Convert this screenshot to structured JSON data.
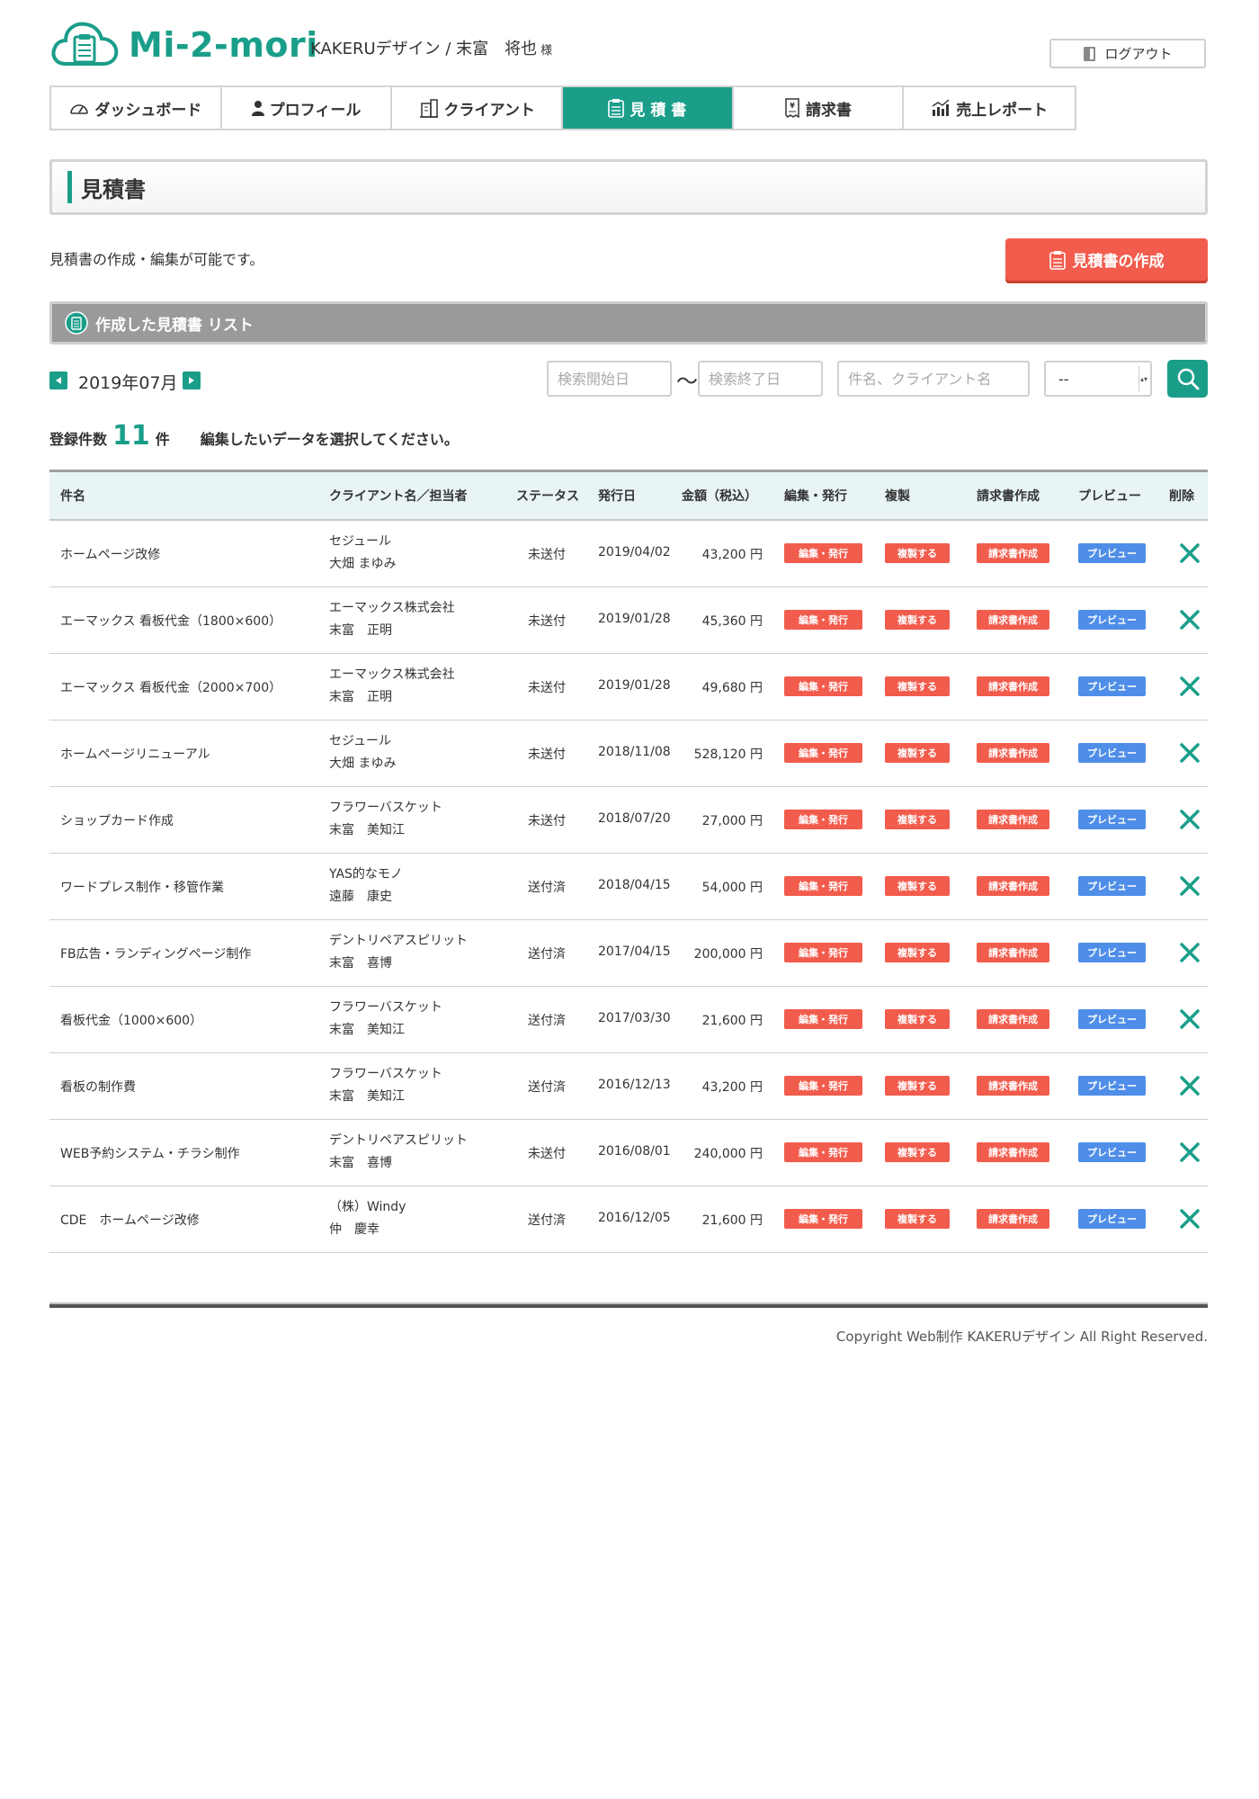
{
  "header": {
    "logo_text": "Mi-2-mori",
    "user_name": "KAKERUデザイン / 末富　将也",
    "user_suffix": "様",
    "logout_label": "ログアウト"
  },
  "nav": {
    "items": [
      {
        "label": "ダッシュボード"
      },
      {
        "label": "プロフィール"
      },
      {
        "label": "クライアント"
      },
      {
        "label": "見 積 書"
      },
      {
        "label": "請求書"
      },
      {
        "label": "売上レポート"
      }
    ],
    "active": "見 積 書"
  },
  "page": {
    "title": "見積書",
    "description": "見積書の作成・編集が可能です。",
    "create_button": "見積書の作成",
    "list_title": "作成した見積書 リスト"
  },
  "filters": {
    "month": "2019年07月",
    "start_placeholder": "検索開始日",
    "tilde": "〜",
    "end_placeholder": "検索終了日",
    "keyword_placeholder": "件名、クライアント名",
    "status_select": "--"
  },
  "summary": {
    "label": "登録件数",
    "count": "11",
    "unit": "件",
    "message": "編集したいデータを選択してください。"
  },
  "table": {
    "headers": {
      "name": "件名",
      "client": "クライアント名／担当者",
      "status": "ステータス",
      "date": "発行日",
      "amount": "金額（税込）",
      "edit": "編集・発行",
      "copy": "複製",
      "invoice": "請求書作成",
      "preview": "プレビュー",
      "delete": "削除"
    },
    "buttons": {
      "edit": "編集・発行",
      "copy": "複製する",
      "invoice": "請求書作成",
      "preview": "プレビュー"
    },
    "rows": [
      {
        "name": "ホームページ改修",
        "client": "セジュール",
        "person": "大畑 まゆみ",
        "status": "未送付",
        "date": "2019/04/02",
        "amount": "43,200 円"
      },
      {
        "name": "エーマックス 看板代金（1800×600）",
        "client": "エーマックス株式会社",
        "person": "末富　正明",
        "status": "未送付",
        "date": "2019/01/28",
        "amount": "45,360 円"
      },
      {
        "name": "エーマックス 看板代金（2000×700）",
        "client": "エーマックス株式会社",
        "person": "末富　正明",
        "status": "未送付",
        "date": "2019/01/28",
        "amount": "49,680 円"
      },
      {
        "name": "ホームページリニューアル",
        "client": "セジュール",
        "person": "大畑 まゆみ",
        "status": "未送付",
        "date": "2018/11/08",
        "amount": "528,120 円"
      },
      {
        "name": "ショップカード作成",
        "client": "フラワーバスケット",
        "person": "末富　美知江",
        "status": "未送付",
        "date": "2018/07/20",
        "amount": "27,000 円"
      },
      {
        "name": "ワードプレス制作・移管作業",
        "client": "YAS的なモノ",
        "person": "遠藤　康史",
        "status": "送付済",
        "date": "2018/04/15",
        "amount": "54,000 円"
      },
      {
        "name": "FB広告・ランディングページ制作",
        "client": "デントリペアスピリット",
        "person": "末富　喜博",
        "status": "送付済",
        "date": "2017/04/15",
        "amount": "200,000 円"
      },
      {
        "name": "看板代金（1000×600）",
        "client": "フラワーバスケット",
        "person": "末富　美知江",
        "status": "送付済",
        "date": "2017/03/30",
        "amount": "21,600 円"
      },
      {
        "name": "看板の制作費",
        "client": "フラワーバスケット",
        "person": "末富　美知江",
        "status": "送付済",
        "date": "2016/12/13",
        "amount": "43,200 円"
      },
      {
        "name": "WEB予約システム・チラシ制作",
        "client": "デントリペアスピリット",
        "person": "末富　喜博",
        "status": "未送付",
        "date": "2016/08/01",
        "amount": "240,000 円"
      },
      {
        "name": "CDE　ホームページ改修",
        "client": "（株）Windy",
        "person": "仲　慶幸",
        "status": "送付済",
        "date": "2016/12/05",
        "amount": "21,600 円"
      }
    ]
  },
  "footer": {
    "copyright": "Copyright Web制作 KAKERUデザイン All Right Reserved."
  },
  "colors": {
    "brand": "#1a9e8a",
    "danger": "#f25c4d",
    "preview": "#4f8ee8"
  }
}
